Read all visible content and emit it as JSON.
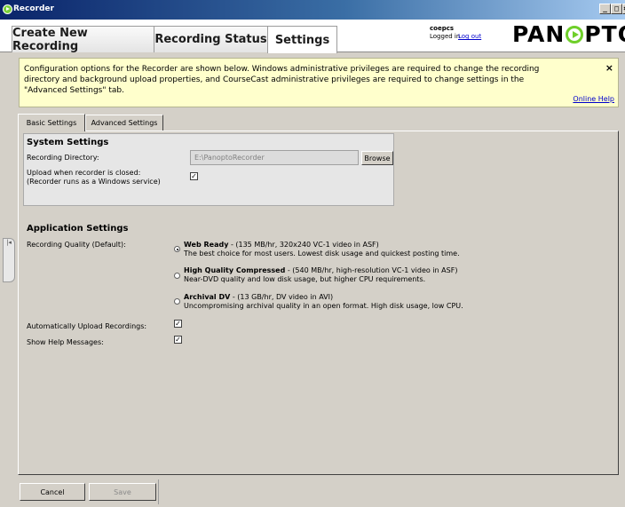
{
  "window": {
    "title": "Recorder",
    "controls": [
      "_",
      "□",
      "×"
    ]
  },
  "tabs": [
    {
      "label": "Create New Recording"
    },
    {
      "label": "Recording Status"
    },
    {
      "label": "Settings"
    }
  ],
  "user": {
    "name": "coepcs",
    "logged_in": "Logged in",
    "logout": "Log out"
  },
  "brand": {
    "left": "PAN",
    "right": "PTO"
  },
  "help": {
    "text": "Configuration options for the Recorder are shown below.  Windows administrative privileges are required to change the recording directory and background upload properties, and CourseCast administrative privileges are required to change settings in the \"Advanced Settings\" tab.",
    "close": "×",
    "link": "Online Help"
  },
  "settings_tabs": [
    {
      "label": "Basic Settings"
    },
    {
      "label": "Advanced Settings"
    }
  ],
  "system": {
    "title": "System Settings",
    "rec_dir_label": "Recording Directory:",
    "rec_dir_value": "E:\\PanoptoRecorder",
    "browse": "Browse",
    "upload_label_1": "Upload when recorder is closed:",
    "upload_label_2": "(Recorder runs as a Windows service)",
    "upload_checked": true
  },
  "application": {
    "title": "Application Settings",
    "quality_label": "Recording Quality (Default):",
    "options": [
      {
        "name": "Web Ready",
        "spec": " - (135 MB/hr, 320x240 VC-1 video in ASF)",
        "desc": "The best choice for most users. Lowest disk usage and quickest posting time.",
        "selected": true
      },
      {
        "name": "High Quality Compressed",
        "spec": " - (540 MB/hr, high-resolution VC-1 video in ASF)",
        "desc": "Near-DVD quality and low disk usage, but higher CPU requirements.",
        "selected": false
      },
      {
        "name": "Archival DV",
        "spec": " - (13 GB/hr, DV video in AVI)",
        "desc": "Uncompromising archival quality in an open format. High disk usage, low CPU.",
        "selected": false
      }
    ],
    "auto_upload_label": "Automatically Upload Recordings:",
    "auto_upload_checked": true,
    "help_msgs_label": "Show Help Messages:",
    "help_msgs_checked": true
  },
  "buttons": {
    "cancel": "Cancel",
    "save": "Save"
  },
  "icons": {
    "check": "✓",
    "collapse": "|◂"
  }
}
